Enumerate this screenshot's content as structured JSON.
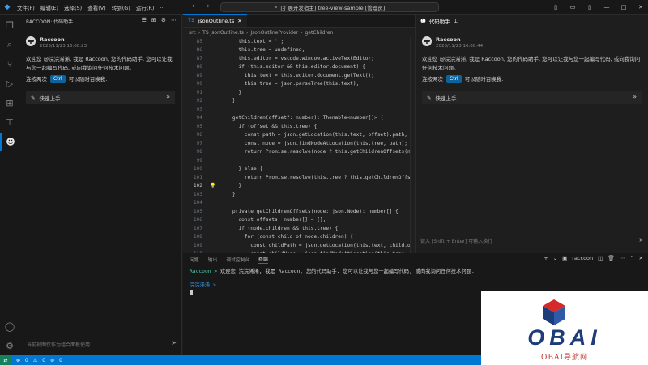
{
  "titlebar": {
    "menus": [
      "文件(F)",
      "编辑(E)",
      "选择(S)",
      "查看(V)",
      "转到(G)",
      "运行(R)",
      "..."
    ],
    "command_center": "[扩展开发宿主] tree-view-sample [管理员]"
  },
  "left_panel": {
    "title": "RACCOON: 代码助手",
    "message": {
      "name": "Raccoon",
      "time": "2023/11/23 16:08:23",
      "body": "欢迎您 @浣浣浠浠, 我是 Raccoon, 您的代码助手, 您可以让我与您一起编写代码, 或向我询问任何技术问题。",
      "kbd_prefix": "连按两次",
      "kbd_key": "Ctrl",
      "kbd_suffix": "可以随时召唤我."
    },
    "quick_start": "快速上手",
    "input_placeholder": "当前视图仅作为组合面板使用"
  },
  "editor": {
    "tab_lang": "TS",
    "tab_name": "jsonOutline.ts",
    "breadcrumb": [
      "src",
      "TS jsonOutline.ts",
      "JsonOutlineProvider",
      "getChildren"
    ],
    "lines": [
      {
        "n": "85",
        "indent": 3,
        "code": "this.text = '';"
      },
      {
        "n": "86",
        "indent": 3,
        "code": "this.tree = undefined;"
      },
      {
        "n": "87",
        "indent": 3,
        "code": "this.editor = vscode.window.activeTextEditor;"
      },
      {
        "n": "88",
        "indent": 3,
        "code": "if (this.editor && this.editor.document) {"
      },
      {
        "n": "89",
        "indent": 4,
        "code": "this.text = this.editor.document.getText();"
      },
      {
        "n": "90",
        "indent": 4,
        "code": "this.tree = json.parseTree(this.text);"
      },
      {
        "n": "91",
        "indent": 3,
        "code": "}"
      },
      {
        "n": "92",
        "indent": 2,
        "code": "}"
      },
      {
        "n": "93",
        "indent": 0,
        "code": ""
      },
      {
        "n": "94",
        "indent": 2,
        "code": "getChildren(offset?: number): Thenable<number[]> {"
      },
      {
        "n": "95",
        "indent": 3,
        "code": "if (offset && this.tree) {"
      },
      {
        "n": "96",
        "indent": 4,
        "code": "const path = json.getLocation(this.text, offset).path;"
      },
      {
        "n": "97",
        "indent": 4,
        "code": "const node = json.findNodeAtLocation(this.tree, path);"
      },
      {
        "n": "98",
        "indent": 4,
        "code": "return Promise.resolve(node ? this.getChildrenOffsets(node) :"
      },
      {
        "n": "99",
        "indent": 0,
        "code": ""
      },
      {
        "n": "100",
        "indent": 3,
        "code": "} else {"
      },
      {
        "n": "101",
        "indent": 4,
        "code": "return Promise.resolve(this.tree ? this.getChildrenOffsets(th"
      },
      {
        "n": "102",
        "indent": 3,
        "code": "}"
      },
      {
        "n": "103",
        "indent": 2,
        "code": "}"
      },
      {
        "n": "104",
        "indent": 0,
        "code": ""
      },
      {
        "n": "105",
        "indent": 2,
        "code": "private getChildrenOffsets(node: json.Node): number[] {"
      },
      {
        "n": "106",
        "indent": 3,
        "code": "const offsets: number[] = [];"
      },
      {
        "n": "107",
        "indent": 3,
        "code": "if (node.children && this.tree) {"
      },
      {
        "n": "108",
        "indent": 4,
        "code": "for (const child of node.children) {"
      },
      {
        "n": "109",
        "indent": 5,
        "code": "const childPath = json.getLocation(this.text, child.offse"
      },
      {
        "n": "110",
        "indent": 5,
        "code": "const childNode = json.findNodeAtLocation(this.tree, chil"
      },
      {
        "n": "111",
        "indent": 5,
        "code": "if (childNode) {"
      },
      {
        "n": "112",
        "indent": 6,
        "code": "offsets.push(childNode.offset);"
      }
    ],
    "current_line": "102"
  },
  "right_panel": {
    "tab_title": "代码助手",
    "message": {
      "name": "Raccoon",
      "time": "2023/11/23 16:08:44",
      "body": "欢迎您 @浣浣浠浠, 我是 Raccoon, 您的代码助手, 您可以让我与您一起编写代码, 或向我询问任何技术问题。",
      "kbd_prefix": "连按两次",
      "kbd_key": "Ctrl",
      "kbd_suffix": "可以随时召唤我."
    },
    "quick_start": "快速上手",
    "input_placeholder": "键入 [Shift + Enter] 可输入换行"
  },
  "bottom_panel": {
    "tabs": [
      "问题",
      "输出",
      "调试控制台",
      "终端"
    ],
    "active_tab": "终端",
    "terminal_name": "raccoon",
    "terminal_line_who": "Raccoon >",
    "terminal_line_text": "欢迎您 浣浣浠浠, 我是 Raccoon, 您的代码助手. 您可以让我与您一起编写代码, 或向我询问任何技术问题.",
    "prompt": "浣浣浠浠 >"
  },
  "statusbar": {
    "errors": "0",
    "warnings": "0",
    "ports": "0"
  },
  "watermark": {
    "brand": "OBAI",
    "sub": "OBAI导航网"
  }
}
